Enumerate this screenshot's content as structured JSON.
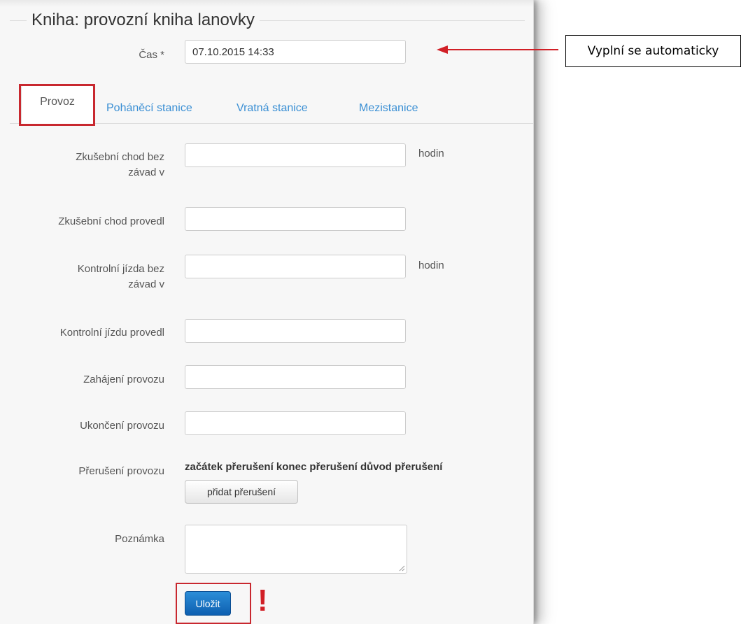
{
  "form": {
    "title": "Kniha: provozní kniha lanovky",
    "time_label": "Čas *",
    "time_value": "07.10.2015 14:33"
  },
  "tabs": [
    {
      "label": "Provoz",
      "active": true
    },
    {
      "label": "Poháněcí stanice",
      "active": false
    },
    {
      "label": "Vratná stanice",
      "active": false
    },
    {
      "label": "Mezistanice",
      "active": false
    }
  ],
  "fields": {
    "zkusebni_chod_label_1": "Zkušební chod bez",
    "zkusebni_chod_label_2": "závad v",
    "zkusebni_chod_suffix": "hodin",
    "zkusebni_chod_provedl_label": "Zkušební chod provedl",
    "kontrolni_jizda_label_1": "Kontrolní jízda bez",
    "kontrolni_jizda_label_2": "závad v",
    "kontrolni_jizda_suffix": "hodin",
    "kontrolni_jizdu_provedl_label": "Kontrolní jízdu provedl",
    "zahajeni_label": "Zahájení provozu",
    "ukonceni_label": "Ukončení provozu",
    "preruseni_label": "Přerušení provozu",
    "preruseni_headers": "začátek přerušení konec přerušení důvod přerušení",
    "pridat_preruseni_label": "přidat přerušení",
    "poznamka_label": "Poznámka"
  },
  "actions": {
    "save_label": "Uložit",
    "exclaim": "!"
  },
  "annotation": {
    "callout_text": "Vyplní se automaticky"
  },
  "colors": {
    "highlight": "#c8282f",
    "tab_link": "#3a8fd4",
    "primary_button": "#0e5fb0",
    "arrow": "#d11f26"
  }
}
